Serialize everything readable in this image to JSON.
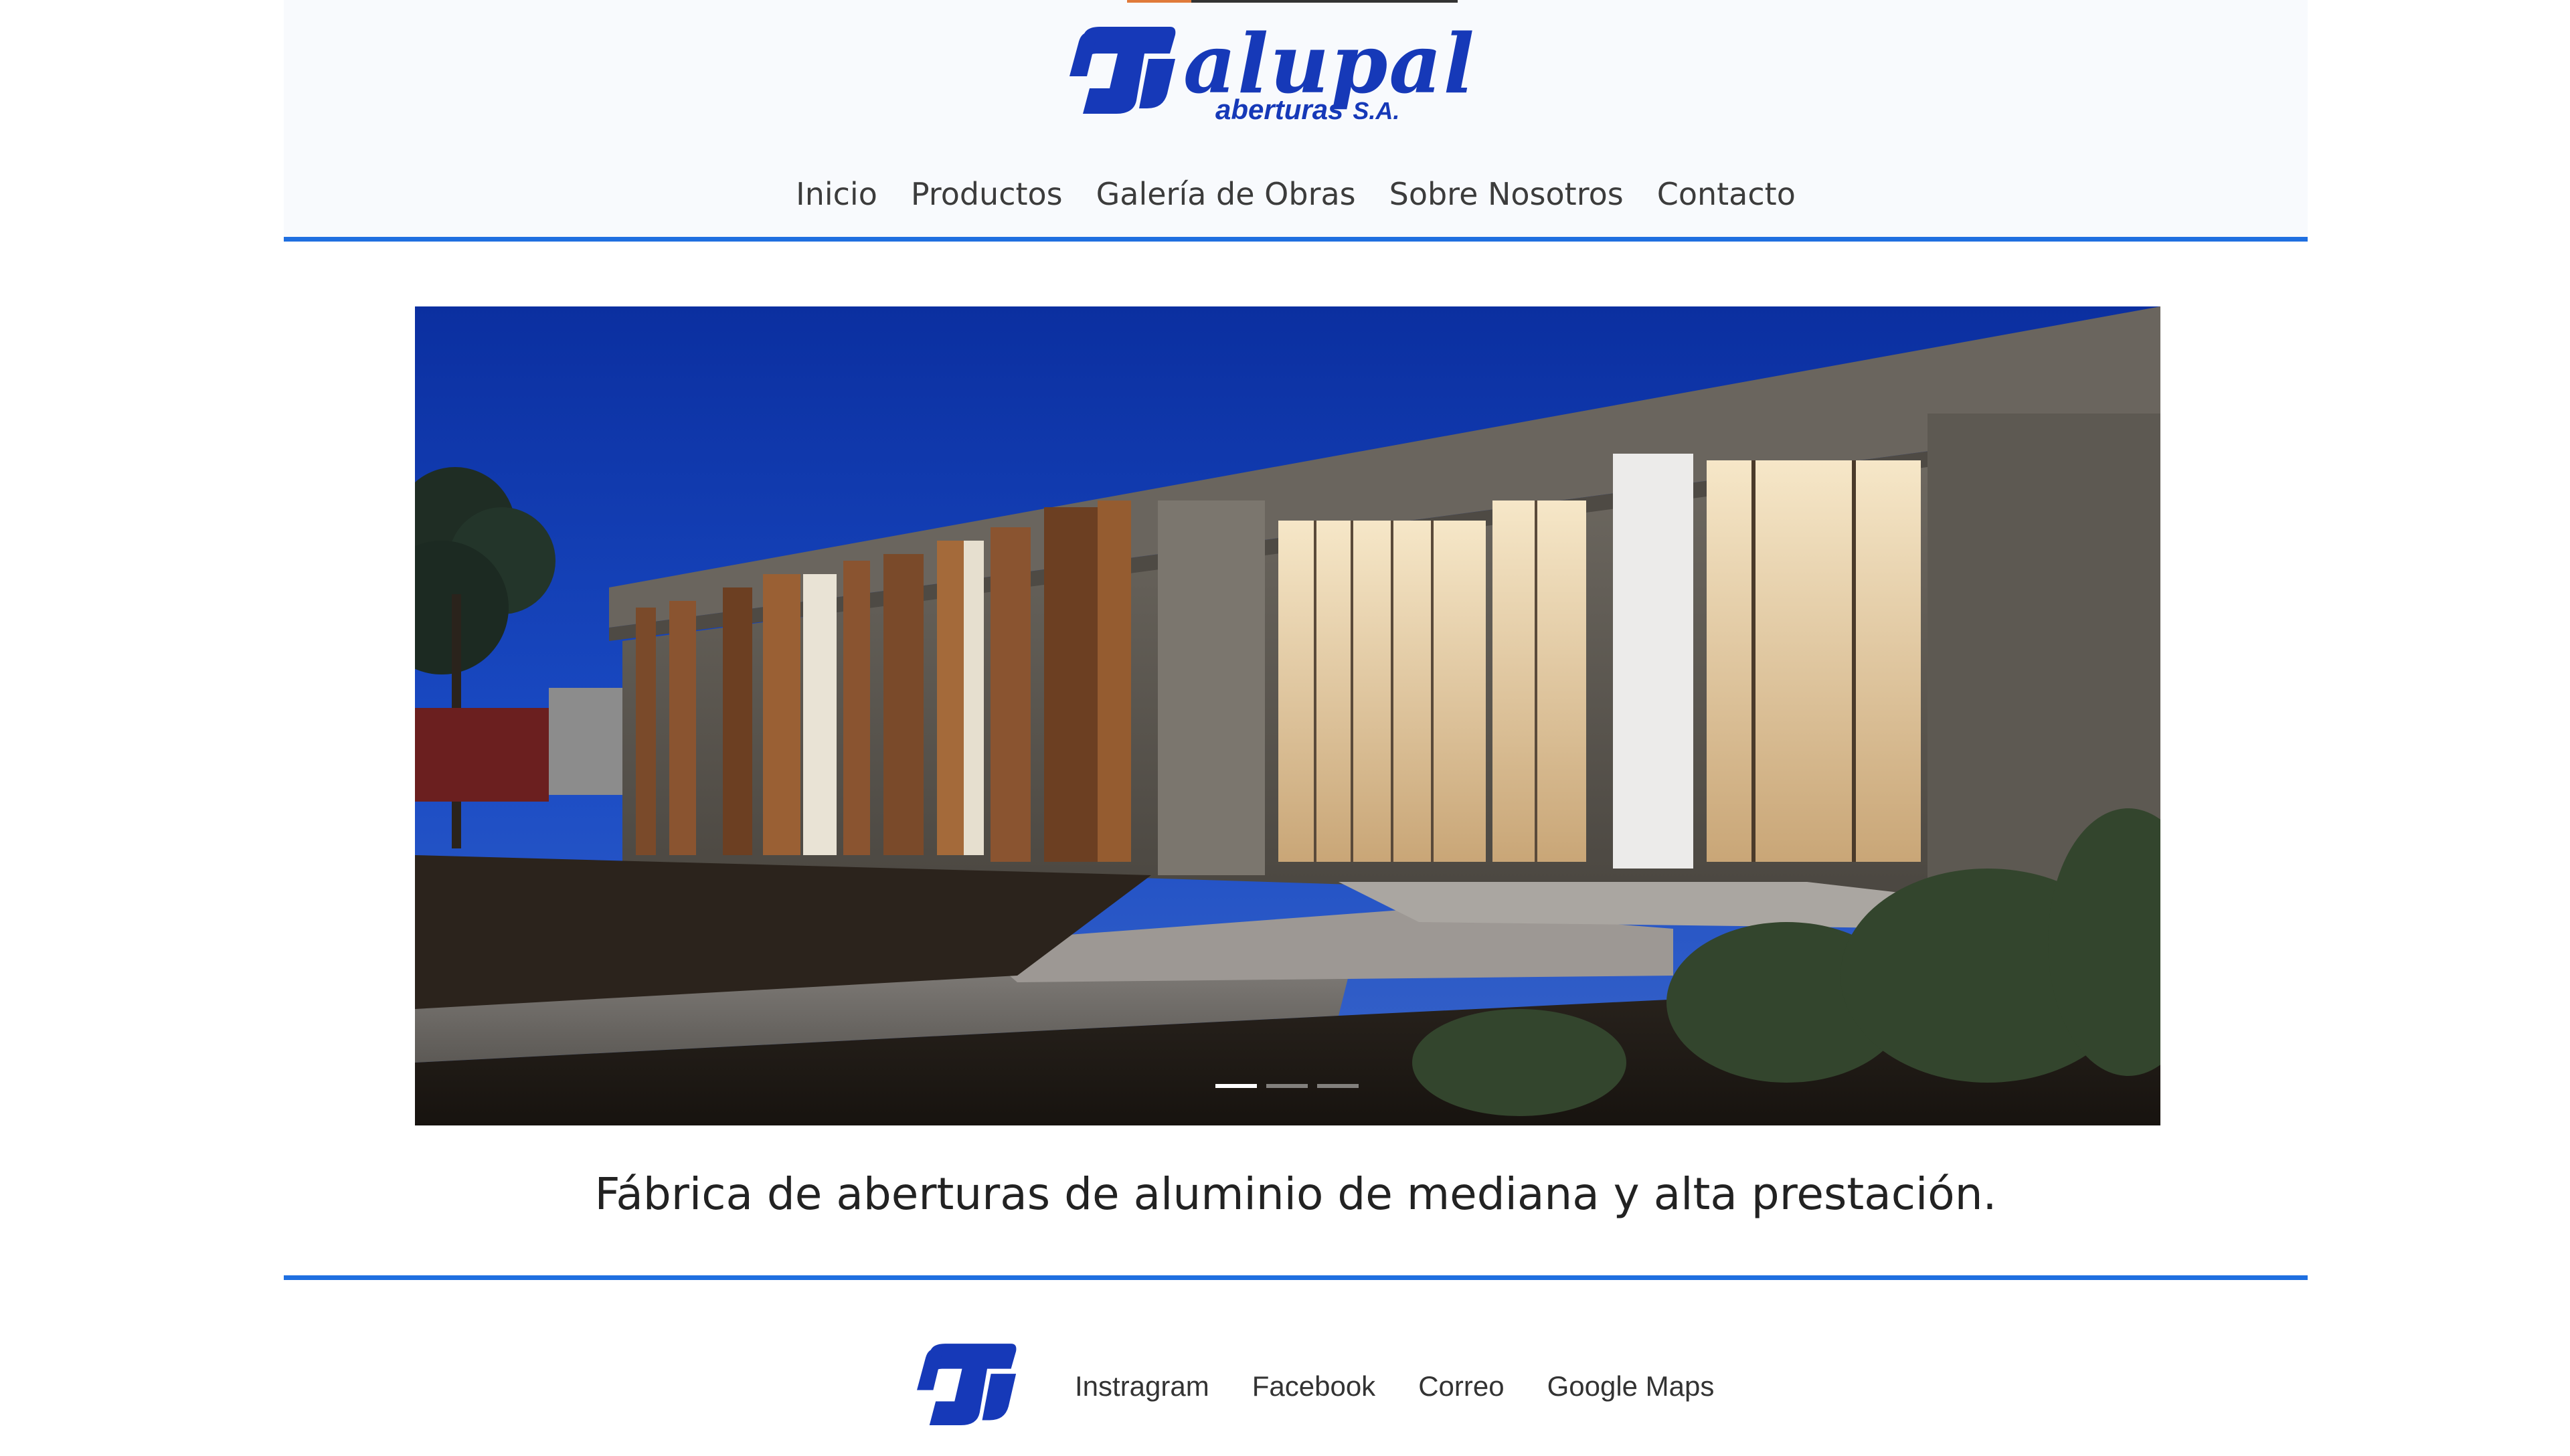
{
  "brand": {
    "name": "alupal",
    "subtitle": "aberturas",
    "suffix": "S.A.",
    "color": "#1639b8"
  },
  "nav": {
    "items": [
      {
        "label": "Inicio"
      },
      {
        "label": "Productos"
      },
      {
        "label": "Galería de Obras"
      },
      {
        "label": "Sobre Nosotros"
      },
      {
        "label": "Contacto"
      }
    ]
  },
  "accent_color": "#1f6fe0",
  "hero": {
    "slide_count": 3,
    "active_slide": 1
  },
  "tagline": "Fábrica de aberturas de aluminio de mediana y alta prestación.",
  "footer": {
    "links": [
      {
        "label": "Instragram"
      },
      {
        "label": "Facebook"
      },
      {
        "label": "Correo"
      },
      {
        "label": "Google Maps"
      }
    ]
  }
}
